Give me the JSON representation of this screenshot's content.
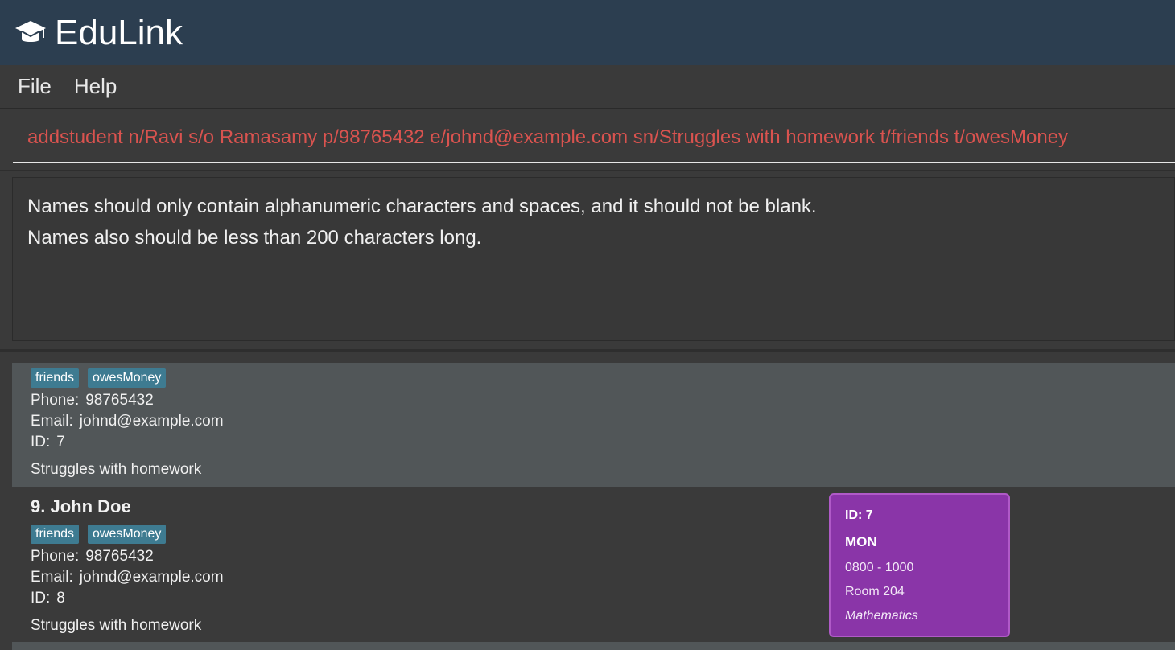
{
  "app": {
    "title": "EduLink",
    "logo_icon": "graduation-cap-icon"
  },
  "menu": {
    "file_label": "File",
    "help_label": "Help"
  },
  "command": {
    "text": "addstudent n/Ravi s/o Ramasamy p/98765432 e/johnd@example.com sn/Struggles with homework t/friends t/owesMoney",
    "error_color": "#d9534f"
  },
  "result": {
    "line1": "Names should only contain alphanumeric characters and spaces, and it should not be blank.",
    "line2": "Names also should be less than 200 characters long."
  },
  "students": [
    {
      "name": "",
      "tags": [
        "friends",
        "owesMoney"
      ],
      "phone_label": "Phone:",
      "phone": "98765432",
      "email_label": "Email:",
      "email": "johnd@example.com",
      "id_label": "ID:",
      "id": "7",
      "note": "Struggles with homework"
    },
    {
      "name": "9. John Doe",
      "tags": [
        "friends",
        "owesMoney"
      ],
      "phone_label": "Phone:",
      "phone": "98765432",
      "email_label": "Email:",
      "email": "johnd@example.com",
      "id_label": "ID:",
      "id": "8",
      "note": "Struggles with homework"
    }
  ],
  "lesson": {
    "id": "ID: 7",
    "day": "MON",
    "time": "0800 - 1000",
    "room": "Room 204",
    "subject": "Mathematics",
    "color": "#8a35a8"
  }
}
